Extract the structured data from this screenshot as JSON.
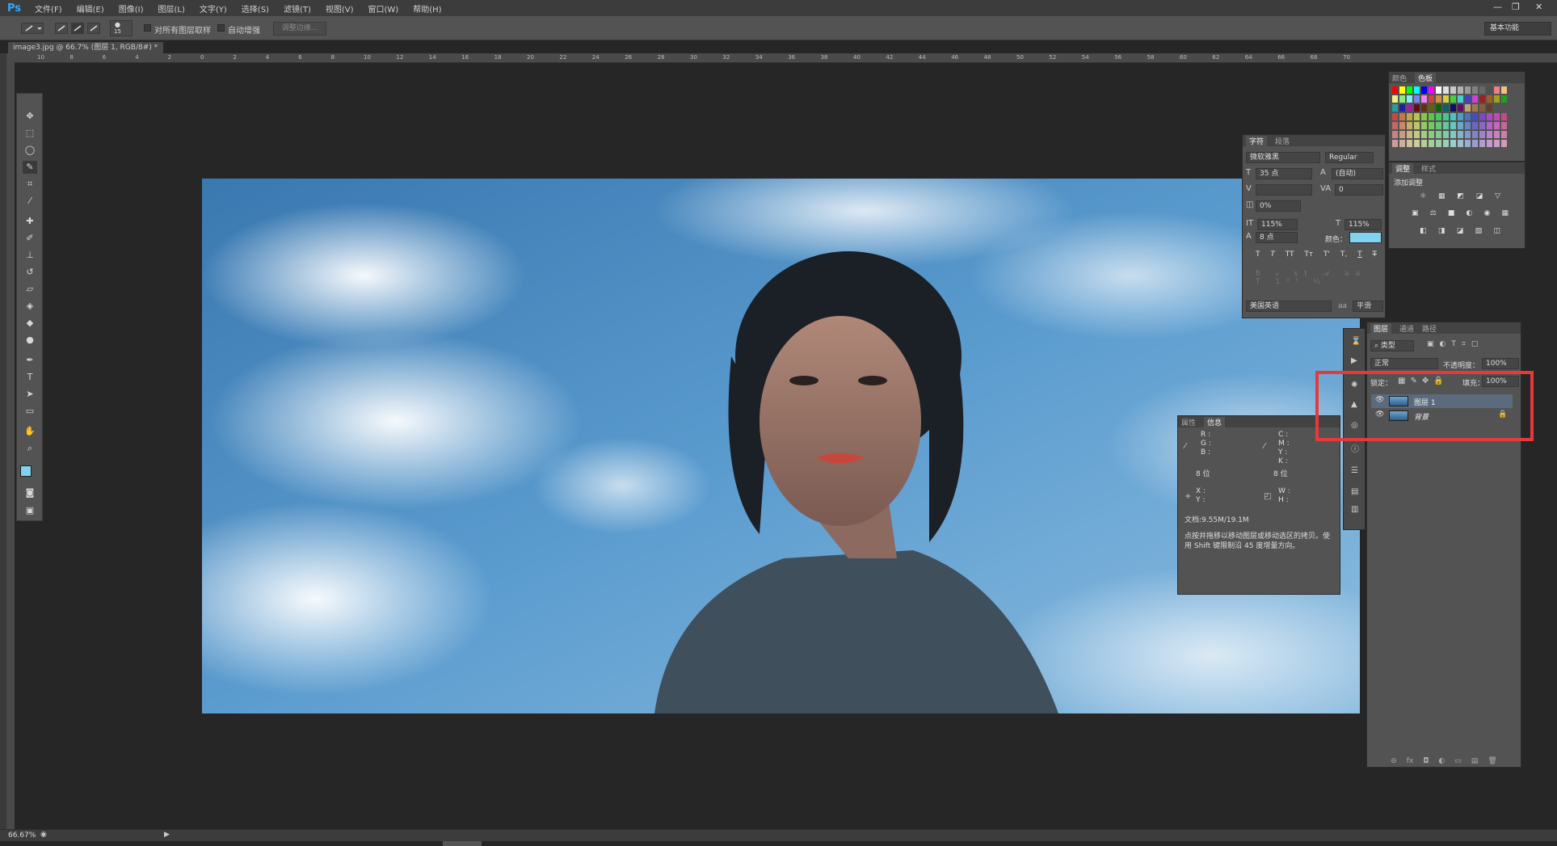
{
  "app": {
    "logo": "Ps",
    "menus": [
      "文件(F)",
      "编辑(E)",
      "图像(I)",
      "图层(L)",
      "文字(Y)",
      "选择(S)",
      "滤镜(T)",
      "视图(V)",
      "窗口(W)",
      "帮助(H)"
    ],
    "window_controls": [
      "—",
      "❐",
      "✕"
    ]
  },
  "options": {
    "brush_size": "15",
    "sample_all_layers": "对所有图层取样",
    "auto_enhance": "自动增强",
    "refine_edge": "调整边缘...",
    "workspace": "基本功能"
  },
  "document": {
    "tab": "image3.jpg @ 66.7% (图层 1, RGB/8#) *",
    "close": "×",
    "zoom": "66.67%"
  },
  "ruler": {
    "h_ticks": [
      "10",
      "8",
      "6",
      "4",
      "2",
      "0",
      "2",
      "4",
      "6",
      "8",
      "10",
      "12",
      "14",
      "16",
      "18",
      "20",
      "22",
      "24",
      "26",
      "28",
      "30",
      "32",
      "34",
      "36",
      "38",
      "40",
      "42",
      "44",
      "46",
      "48",
      "50",
      "52",
      "54",
      "56",
      "58",
      "60",
      "62",
      "64",
      "66",
      "68",
      "70"
    ]
  },
  "swatches": {
    "tabs": [
      "颜色",
      "色板"
    ],
    "colors": [
      "#ff0000",
      "#ffff00",
      "#00ff00",
      "#00ffff",
      "#0000ff",
      "#ff00ff",
      "#ffffff",
      "#e0e0e0",
      "#c8c8c8",
      "#b0b0b0",
      "#989898",
      "#808080",
      "#686868",
      "#505050",
      "#f08080",
      "#f0c080",
      "#f0f080",
      "#80f080",
      "#80f0f0",
      "#8080f0",
      "#f080f0",
      "#d04040",
      "#d09040",
      "#d0d040",
      "#40d040",
      "#40d0d0",
      "#4040d0",
      "#d040d0",
      "#a02020",
      "#a06020",
      "#a0a020",
      "#20a020",
      "#20a0a0",
      "#2020a0",
      "#a020a0",
      "#601010",
      "#603010",
      "#606010",
      "#106010",
      "#106060",
      "#101060",
      "#601060",
      "#c8a070",
      "#a07850",
      "#806040",
      "#604028"
    ]
  },
  "character": {
    "tabs": [
      "字符",
      "段落"
    ],
    "font": "微软雅黑",
    "style": "Regular",
    "size": "35 点",
    "leading": "(自动)",
    "kerning": "",
    "tracking": "0",
    "scale_pct": "0%",
    "vscale": "115%",
    "hscale": "115%",
    "baseline": "8 点",
    "color_label": "颜色：",
    "color": "#7fd3ef",
    "styles": [
      "T",
      "T",
      "TT",
      "Tт",
      "T'",
      "T,",
      "T",
      "T"
    ],
    "language": "美国英语",
    "aa_label": "aa",
    "aa": "平滑"
  },
  "adjustments": {
    "tabs": [
      "调整",
      "样式"
    ],
    "title": "添加调整",
    "row1": [
      "☼",
      "▦",
      "◩",
      "◪",
      "▽"
    ],
    "row2": [
      "▣",
      "⚖",
      "■",
      "◐",
      "◉",
      "▦"
    ],
    "row3": [
      "◧",
      "◨",
      "◪",
      "▧",
      "◫"
    ]
  },
  "layers": {
    "tabs": [
      "图层",
      "通道",
      "路径"
    ],
    "kind": "类型",
    "blend": "正常",
    "opacity_label": "不透明度：",
    "opacity": "100%",
    "lock_label": "锁定：",
    "fill_label": "填充：",
    "fill": "100%",
    "items": [
      {
        "name": "图层 1",
        "selected": true
      },
      {
        "name": "背景",
        "locked": true
      }
    ],
    "footer": [
      "⊖",
      "fx",
      "◘",
      "◐",
      "▭",
      "▤",
      "🗑"
    ]
  },
  "info": {
    "tabs": [
      "属性",
      "信息"
    ],
    "r": "R :",
    "g": "G :",
    "b": "B :",
    "c": "C :",
    "m": "M :",
    "y": "Y :",
    "k": "K :",
    "bits1": "8 位",
    "bits2": "8 位",
    "x": "X :",
    "yy": "Y :",
    "w": "W :",
    "h": "H :",
    "doc": "文档:9.55M/19.1M",
    "hint": "点按并拖移以移动图层或移动选区的拷贝。使用 Shift 键限制沿 45 度增量方向。"
  }
}
